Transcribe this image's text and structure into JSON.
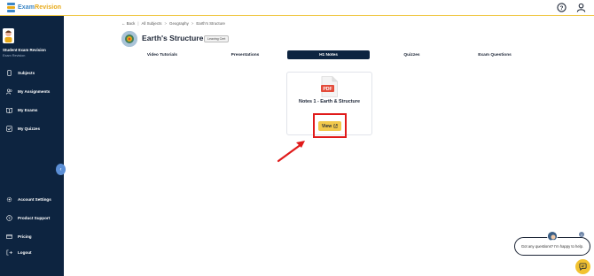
{
  "app": {
    "logo_part1": "Exam",
    "logo_part2": "Revision"
  },
  "header": {
    "icons": [
      "help-circle-icon",
      "user-icon"
    ]
  },
  "sidebar": {
    "user_name": "Student Exam Revision",
    "user_role": "Exam Revision",
    "nav": [
      {
        "label": "Subjects",
        "icon": "phone-icon"
      },
      {
        "label": "My Assignments",
        "icon": "users-icon"
      },
      {
        "label": "My Exams",
        "icon": "book-icon"
      },
      {
        "label": "My Quizzes",
        "icon": "checkbox-icon"
      }
    ],
    "footer_nav": [
      {
        "label": "Account Settings",
        "icon": "gear-icon"
      },
      {
        "label": "Product Support",
        "icon": "help-icon"
      },
      {
        "label": "Pricing",
        "icon": "card-icon"
      },
      {
        "label": "Logout",
        "icon": "logout-icon"
      }
    ],
    "collapse_glyph": "‹"
  },
  "breadcrumb": {
    "back": "← Back",
    "items": [
      "All Subjects",
      "Geography",
      "Earth's Structure"
    ],
    "sep": ">",
    "divider": "|"
  },
  "page": {
    "title": "Earth's Structure",
    "badge": "Leaving Cert"
  },
  "tabs": [
    {
      "label": "Video Tutorials",
      "active": false
    },
    {
      "label": "Presentations",
      "active": false
    },
    {
      "label": "H1 Notes",
      "active": true
    },
    {
      "label": "Quizzes",
      "active": false
    },
    {
      "label": "Exam Questions",
      "active": false
    }
  ],
  "notes_card": {
    "file_type": "PDF",
    "title": "Notes 1 - Earth & Structure",
    "button_label": "View",
    "button_icon": "external-link-icon"
  },
  "chat": {
    "message": "Got any questions? I'm happy to help.",
    "close_glyph": "×"
  },
  "colors": {
    "sidebar_bg": "#0d2440",
    "accent_yellow": "#f2c94c",
    "highlight_red": "#e01a1a",
    "active_tab_bg": "#0d2440"
  }
}
